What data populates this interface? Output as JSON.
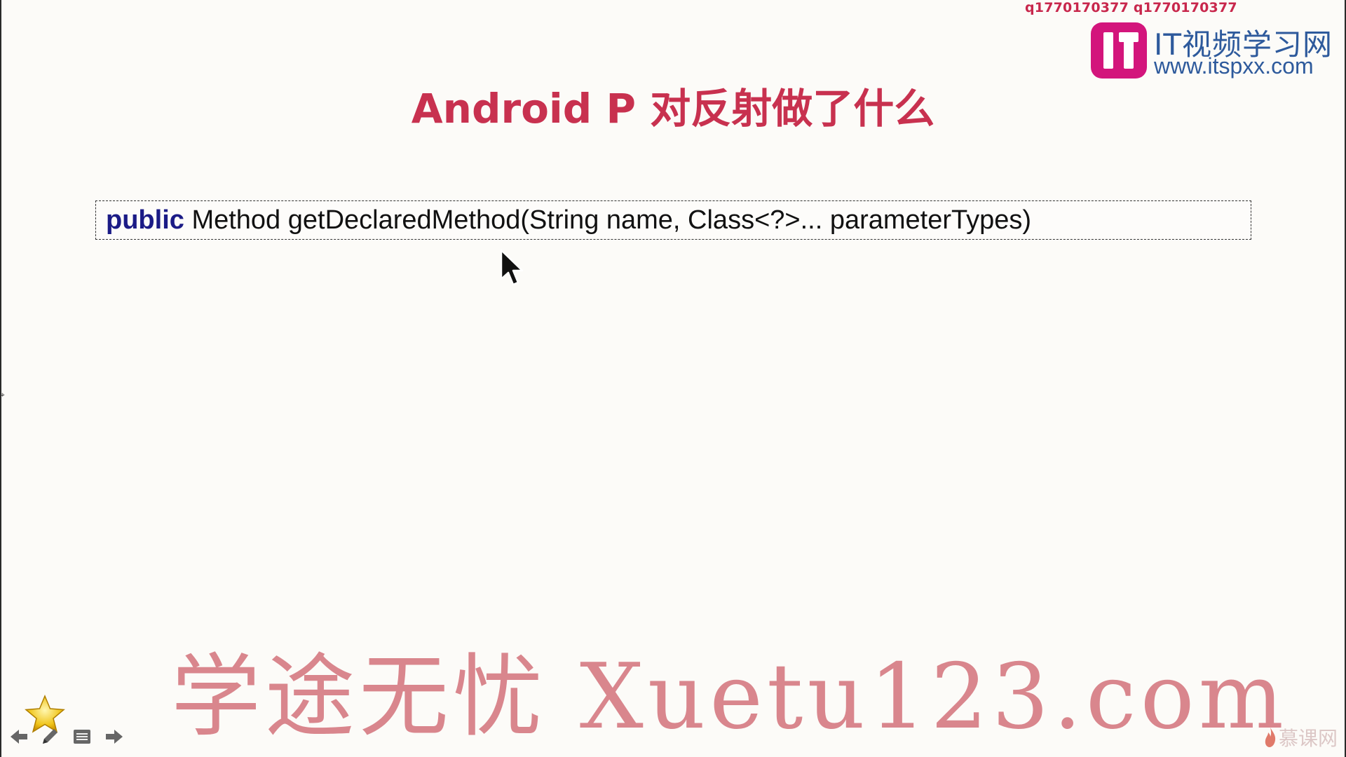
{
  "watermark_top": "q1770170377 q1770170377",
  "logo": {
    "name": "IT视频学习网",
    "url": "www.itspxx.com"
  },
  "slide": {
    "title": "Android P 对反射做了什么",
    "code": {
      "keyword": "public",
      "rest": " Method getDeclaredMethod(String name, Class<?>... parameterTypes)"
    }
  },
  "watermark_bottom": "学途无忧 Xuetu123.com",
  "mooc_brand": "慕课网",
  "colors": {
    "title_red": "#c8314f",
    "keyword_blue": "#1b1b86",
    "logo_magenta": "#d3157c",
    "logo_blue": "#2e5a9c",
    "watermark_pink": "#d9868d"
  },
  "controls": {
    "icons": [
      "star-icon",
      "back-arrow-icon",
      "pen-icon",
      "menu-icon",
      "forward-arrow-icon"
    ]
  }
}
